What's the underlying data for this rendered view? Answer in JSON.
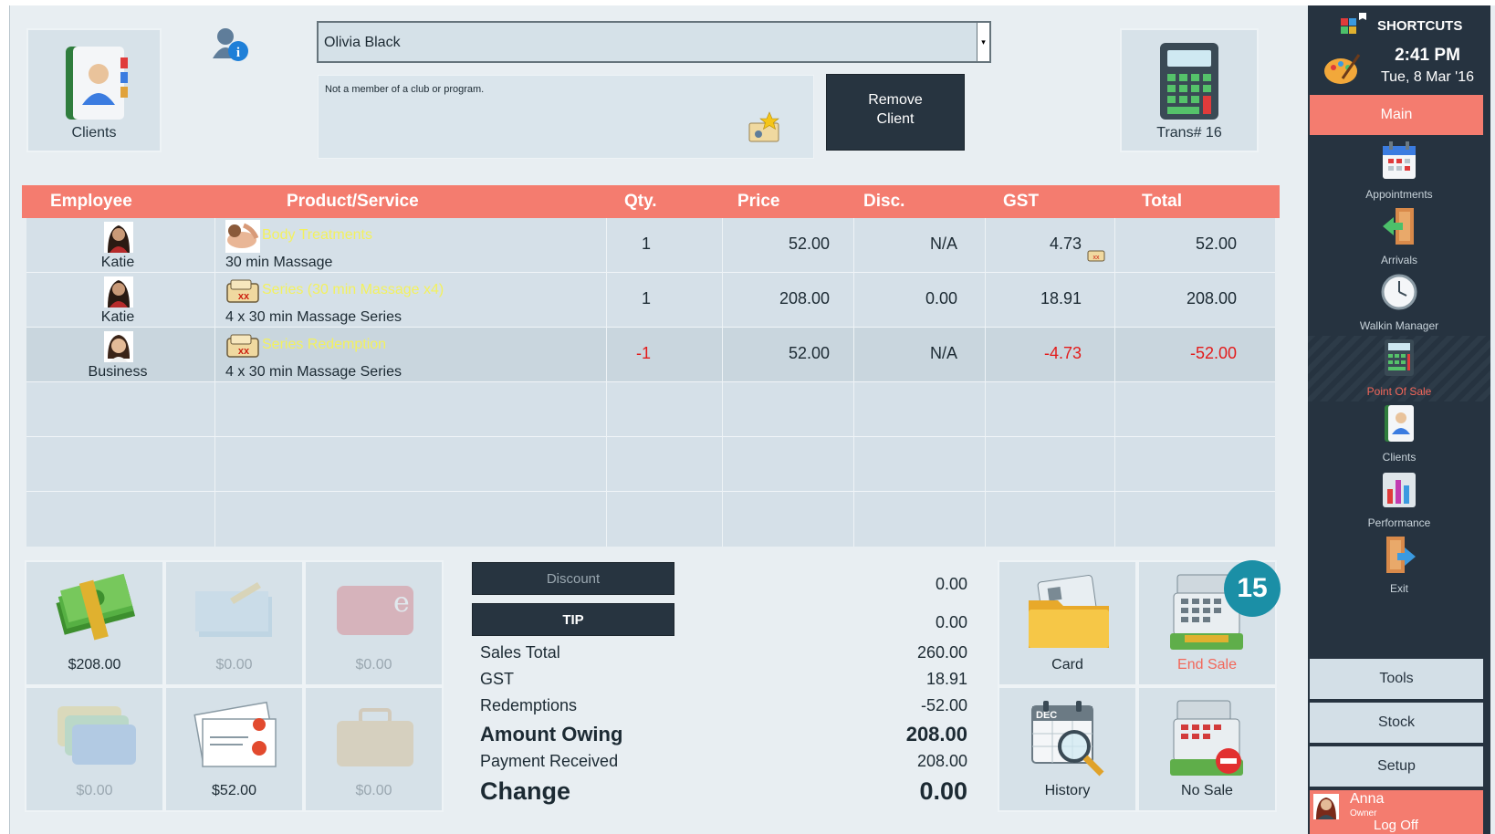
{
  "header": {
    "clients_tile_label": "Clients",
    "client_name": "Olivia Black",
    "client_note": "Not a member of a club or program.",
    "remove_client_line1": "Remove",
    "remove_client_line2": "Client",
    "trans_label": "Trans# 16"
  },
  "table": {
    "columns": [
      "Employee",
      "Product/Service",
      "Qty.",
      "Price",
      "Disc.",
      "GST",
      "Total"
    ],
    "rows": [
      {
        "employee": "Katie",
        "category": "Body Treatments",
        "product": "30 min Massage",
        "qty": "1",
        "price": "52.00",
        "disc": "N/A",
        "gst": "4.73",
        "total": "52.00"
      },
      {
        "employee": "Katie",
        "category": "Series (30 min Massage x4)",
        "product": "4 x 30 min Massage Series",
        "qty": "1",
        "price": "208.00",
        "disc": "0.00",
        "gst": "18.91",
        "total": "208.00"
      },
      {
        "employee": "Business",
        "category": "Series Redemption",
        "product": "4 x 30 min Massage Series",
        "qty": "-1",
        "price": "52.00",
        "disc": "N/A",
        "gst": "-4.73",
        "total": "-52.00"
      }
    ]
  },
  "payments": {
    "cash": "$208.00",
    "cheque": "$0.00",
    "eftpos": "$0.00",
    "credit_card": "$0.00",
    "gift_voucher": "$52.00",
    "account": "$0.00"
  },
  "totals": {
    "discount_label": "Discount",
    "discount_value": "0.00",
    "tip_label": "TIP",
    "tip_value": "0.00",
    "sales_total_label": "Sales Total",
    "sales_total_value": "260.00",
    "gst_label": "GST",
    "gst_value": "18.91",
    "redemptions_label": "Redemptions",
    "redemptions_value": "-52.00",
    "amount_owing_label": "Amount Owing",
    "amount_owing_value": "208.00",
    "payment_received_label": "Payment Received",
    "payment_received_value": "208.00",
    "change_label": "Change",
    "change_value": "0.00"
  },
  "actions": {
    "card": "Card",
    "end_sale": "End Sale",
    "end_sale_badge": "15",
    "history": "History",
    "no_sale": "No Sale"
  },
  "sidebar": {
    "shortcuts": "SHORTCUTS",
    "time": "2:41 PM",
    "date": "Tue, 8 Mar '16",
    "main": "Main",
    "items": [
      {
        "label": "Appointments"
      },
      {
        "label": "Arrivals"
      },
      {
        "label": "Walkin Manager"
      },
      {
        "label": "Point Of Sale"
      },
      {
        "label": "Clients"
      },
      {
        "label": "Performance"
      },
      {
        "label": "Exit"
      }
    ],
    "tools": "Tools",
    "stock": "Stock",
    "setup": "Setup",
    "user_name": "Anna",
    "user_role": "Owner",
    "logoff": "Log Off"
  },
  "colors": {
    "accent": "#f47c6f",
    "sidebar_bg": "#263340",
    "panel": "#d6e1e8",
    "dark_button": "#273440",
    "negative": "#e31b1b",
    "category_text": "#f3f15e",
    "badge": "#1b8fa6"
  }
}
